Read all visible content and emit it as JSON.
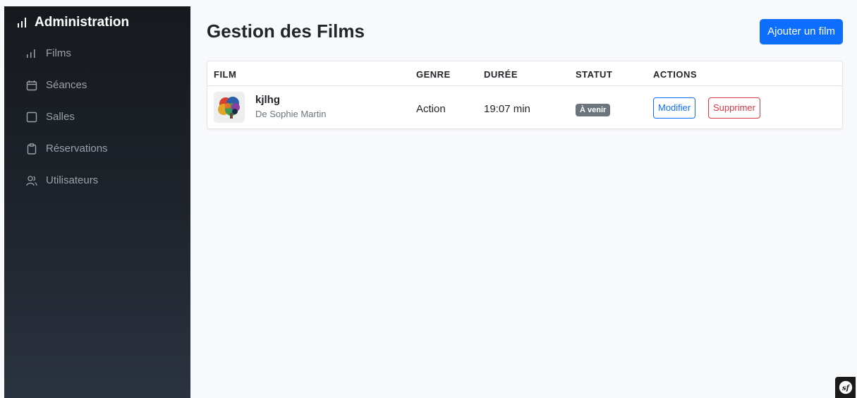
{
  "sidebar": {
    "brand": "Administration",
    "brand_icon": "bar-chart-icon",
    "items": [
      {
        "label": "Films",
        "icon": "bar-chart-icon"
      },
      {
        "label": "Séances",
        "icon": "calendar-icon"
      },
      {
        "label": "Salles",
        "icon": "square-icon"
      },
      {
        "label": "Réservations",
        "icon": "clipboard-icon"
      },
      {
        "label": "Utilisateurs",
        "icon": "users-icon"
      }
    ]
  },
  "main": {
    "title": "Gestion des Films",
    "add_button": "Ajouter un film"
  },
  "table": {
    "headers": {
      "film": "FILM",
      "genre": "GENRE",
      "duree": "DURÉE",
      "statut": "STATUT",
      "actions": "ACTIONS"
    },
    "rows": [
      {
        "title": "kjlhg",
        "director": "De Sophie Martin",
        "genre": "Action",
        "duration": "19:07 min",
        "status": "À venir",
        "edit": "Modifier",
        "delete": "Supprimer"
      }
    ]
  },
  "colors": {
    "primary": "#0d6efd",
    "danger": "#dc3545",
    "badge": "#6c757d"
  }
}
